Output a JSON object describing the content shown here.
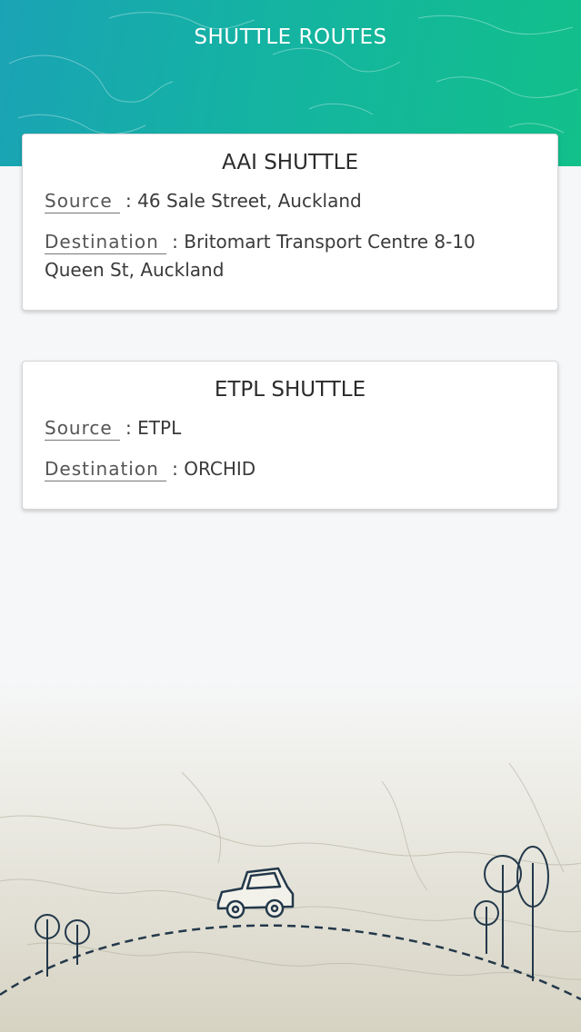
{
  "header": {
    "title": "SHUTTLE ROUTES"
  },
  "routes": [
    {
      "name": "AAI SHUTTLE",
      "source_label": "Source",
      "source_value": "46 Sale Street, Auckland",
      "destination_label": "Destination",
      "destination_value": "Britomart Transport Centre 8-10 Queen St, Auckland"
    },
    {
      "name": "ETPL SHUTTLE",
      "source_label": "Source",
      "source_value": "ETPL",
      "destination_label": "Destination",
      "destination_value": "ORCHID"
    }
  ],
  "colors": {
    "header_gradient_start": "#1aa3b5",
    "header_gradient_end": "#12c08a",
    "card_background": "#ffffff",
    "page_background": "#f6f7f8"
  },
  "decor": {
    "header_background": "world-map-outline",
    "footer_background": "faded-map-illustration",
    "icons": [
      "car-icon",
      "tree-icon",
      "dashed-road"
    ]
  }
}
